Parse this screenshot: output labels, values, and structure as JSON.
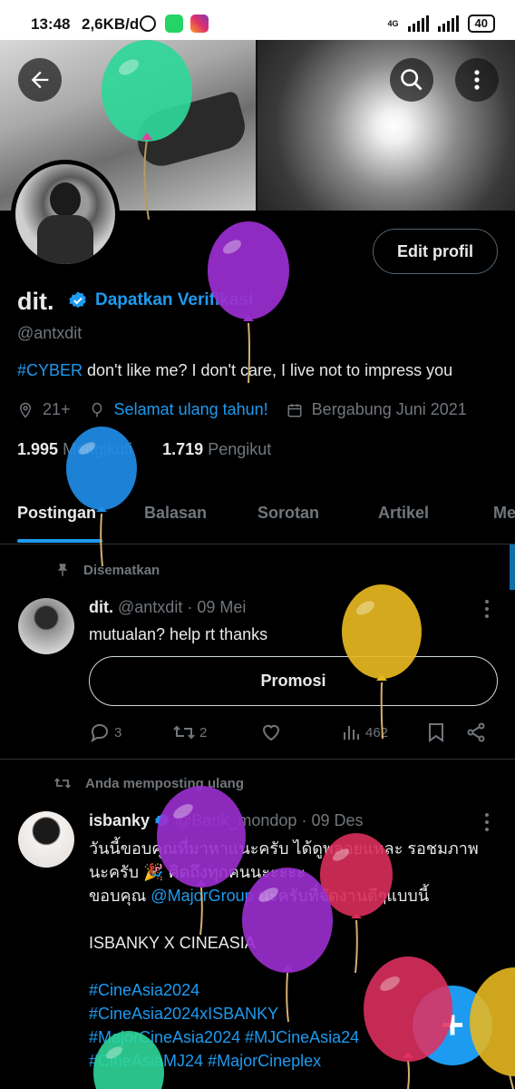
{
  "statusbar": {
    "time": "13:48",
    "speed": "2,6KB/d",
    "network": "4G",
    "battery": "40"
  },
  "header": {
    "back_icon": "arrow-left-icon",
    "search_icon": "search-icon",
    "more_icon": "more-vertical-icon"
  },
  "profile": {
    "edit_label": "Edit profil",
    "name": "dit.",
    "get_verified": "Dapatkan Verifikasi",
    "handle": "@antxdit",
    "bio_tag": "#CYBER",
    "bio_text": " don't like me? I don't care, I live not to impress you",
    "location": "21+",
    "birthday": "Selamat ulang tahun!",
    "joined": "Bergabung Juni 2021",
    "following_count": "1.995",
    "following_label": "Mengikuti",
    "followers_count": "1.719",
    "followers_label": "Pengikut"
  },
  "tabs": [
    "Postingan",
    "Balasan",
    "Sorotan",
    "Artikel",
    "Me"
  ],
  "posts": [
    {
      "context": "Disematkan",
      "name": "dit.",
      "handle": "@antxdit",
      "date": "· 09 Mei",
      "text": "mutualan? help rt thanks",
      "promo_label": "Promosi",
      "replies": "3",
      "reposts": "2",
      "views": "462"
    },
    {
      "context": "Anda memposting ulang",
      "name": "isbanky",
      "handle": "@Bank_mondop",
      "date": "· 09 Des",
      "line1": "วันนี้ขอบคุณที่มาหาแนะครับ ได้ดูพลอยแหละ รอชมภาพ",
      "line2": "นะครับ 🎉 คิดถึงทุกคนนะะะะะ",
      "line3_pre": "ขอบคุณ ",
      "line3_link": "@MajorGroup",
      "line3_post": " นะครับที่จัดงานดีๆแบบนี้",
      "line4": "ISBANKY X CINEASIA",
      "hashtags1": "#CineAsia2024",
      "hashtags2": "#CineAsia2024xISBANKY",
      "hashtags3": "#MajorCineAsia2024 #MJCineAsia24",
      "hashtags4": "#CineAsiaMJ24 #MajorCineplex"
    }
  ],
  "fab_label": "+",
  "colors": {
    "accent": "#1d9bf0",
    "background": "#000000",
    "muted": "#71767b",
    "text": "#e7e9ea"
  }
}
